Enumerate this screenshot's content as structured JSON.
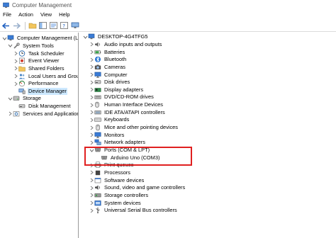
{
  "window": {
    "title": "Computer Management"
  },
  "menu": [
    "File",
    "Action",
    "View",
    "Help"
  ],
  "left_tree": [
    {
      "label": "Computer Management (Local",
      "level": 0,
      "expander": "down",
      "icon": "computer-management-icon"
    },
    {
      "label": "System Tools",
      "level": 1,
      "expander": "down",
      "icon": "tools-icon"
    },
    {
      "label": "Task Scheduler",
      "level": 2,
      "expander": "right",
      "icon": "clock-icon"
    },
    {
      "label": "Event Viewer",
      "level": 2,
      "expander": "right",
      "icon": "event-viewer-icon"
    },
    {
      "label": "Shared Folders",
      "level": 2,
      "expander": "right",
      "icon": "folder-icon"
    },
    {
      "label": "Local Users and Groups",
      "level": 2,
      "expander": "right",
      "icon": "users-icon"
    },
    {
      "label": "Performance",
      "level": 2,
      "expander": "right",
      "icon": "performance-icon"
    },
    {
      "label": "Device Manager",
      "level": 2,
      "expander": "none",
      "icon": "device-manager-icon",
      "selected": true
    },
    {
      "label": "Storage",
      "level": 1,
      "expander": "down",
      "icon": "storage-icon"
    },
    {
      "label": "Disk Management",
      "level": 2,
      "expander": "none",
      "icon": "disk-icon"
    },
    {
      "label": "Services and Applications",
      "level": 1,
      "expander": "right",
      "icon": "services-icon"
    }
  ],
  "device_tree": [
    {
      "label": "DESKTOP-4G4TFG5",
      "level": 0,
      "expander": "down",
      "icon": "computer-icon"
    },
    {
      "label": "Audio inputs and outputs",
      "level": 1,
      "expander": "right",
      "icon": "speaker-icon"
    },
    {
      "label": "Batteries",
      "level": 1,
      "expander": "right",
      "icon": "battery-icon"
    },
    {
      "label": "Bluetooth",
      "level": 1,
      "expander": "right",
      "icon": "bluetooth-icon"
    },
    {
      "label": "Cameras",
      "level": 1,
      "expander": "right",
      "icon": "camera-icon"
    },
    {
      "label": "Computer",
      "level": 1,
      "expander": "right",
      "icon": "monitor-icon"
    },
    {
      "label": "Disk drives",
      "level": 1,
      "expander": "right",
      "icon": "disk-icon"
    },
    {
      "label": "Display adapters",
      "level": 1,
      "expander": "right",
      "icon": "display-adapter-icon"
    },
    {
      "label": "DVD/CD-ROM drives",
      "level": 1,
      "expander": "right",
      "icon": "dvd-icon"
    },
    {
      "label": "Human Interface Devices",
      "level": 1,
      "expander": "right",
      "icon": "hid-icon"
    },
    {
      "label": "IDE ATA/ATAPI controllers",
      "level": 1,
      "expander": "right",
      "icon": "ide-icon"
    },
    {
      "label": "Keyboards",
      "level": 1,
      "expander": "right",
      "icon": "keyboard-icon"
    },
    {
      "label": "Mice and other pointing devices",
      "level": 1,
      "expander": "right",
      "icon": "mouse-icon"
    },
    {
      "label": "Monitors",
      "level": 1,
      "expander": "right",
      "icon": "monitor-icon"
    },
    {
      "label": "Network adapters",
      "level": 1,
      "expander": "right",
      "icon": "network-icon"
    },
    {
      "label": "Ports (COM & LPT)",
      "level": 1,
      "expander": "down",
      "icon": "port-icon"
    },
    {
      "label": "Arduino Uno (COM3)",
      "level": 2,
      "expander": "none",
      "icon": "port-icon"
    },
    {
      "label": "Print queues",
      "level": 1,
      "expander": "right",
      "icon": "printer-icon"
    },
    {
      "label": "Processors",
      "level": 1,
      "expander": "right",
      "icon": "processor-icon"
    },
    {
      "label": "Software devices",
      "level": 1,
      "expander": "right",
      "icon": "software-device-icon"
    },
    {
      "label": "Sound, video and game controllers",
      "level": 1,
      "expander": "right",
      "icon": "sound-icon"
    },
    {
      "label": "Storage controllers",
      "level": 1,
      "expander": "right",
      "icon": "storage-controller-icon"
    },
    {
      "label": "System devices",
      "level": 1,
      "expander": "right",
      "icon": "system-device-icon"
    },
    {
      "label": "Universal Serial Bus controllers",
      "level": 1,
      "expander": "right",
      "icon": "usb-icon"
    }
  ],
  "colors": {
    "selection": "#cce8ff",
    "highlight_box": "#e02020",
    "icon_blue": "#2b6cb0"
  }
}
